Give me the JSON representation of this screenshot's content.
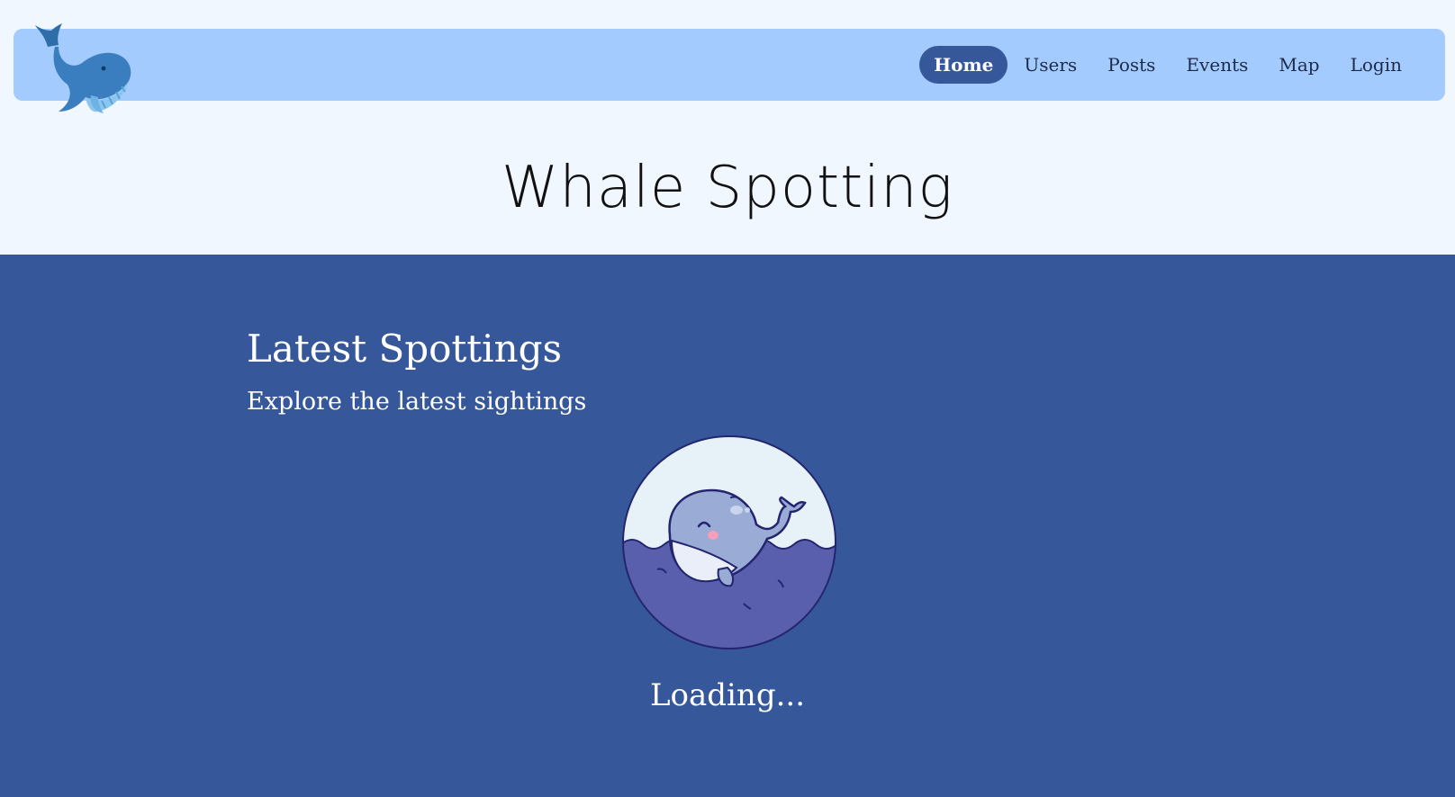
{
  "header": {
    "logo_icon": "whale-logo-icon",
    "nav": [
      {
        "label": "Home",
        "active": true
      },
      {
        "label": "Users",
        "active": false
      },
      {
        "label": "Posts",
        "active": false
      },
      {
        "label": "Events",
        "active": false
      },
      {
        "label": "Map",
        "active": false
      },
      {
        "label": "Login",
        "active": false
      }
    ]
  },
  "hero": {
    "title": "Whale Spotting"
  },
  "main": {
    "title": "Latest Spottings",
    "subtitle": "Explore the latest sightings",
    "loader_icon": "cartoon-whale-icon",
    "loading_text": "Loading..."
  },
  "colors": {
    "navbar_bg": "#a3cbfd",
    "page_bg": "#f0f7ff",
    "main_bg": "#36589a",
    "active_nav_bg": "#36589a"
  }
}
